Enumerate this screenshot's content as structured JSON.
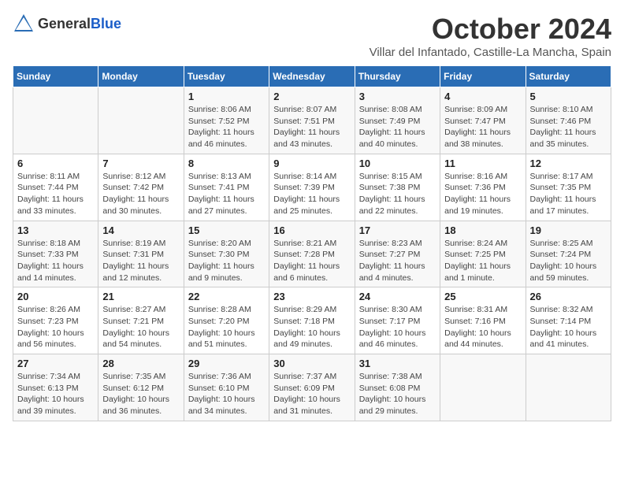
{
  "header": {
    "logo_general": "General",
    "logo_blue": "Blue",
    "month_title": "October 2024",
    "location": "Villar del Infantado, Castille-La Mancha, Spain"
  },
  "days_of_week": [
    "Sunday",
    "Monday",
    "Tuesday",
    "Wednesday",
    "Thursday",
    "Friday",
    "Saturday"
  ],
  "weeks": [
    [
      {
        "day": "",
        "info": ""
      },
      {
        "day": "",
        "info": ""
      },
      {
        "day": "1",
        "info": "Sunrise: 8:06 AM\nSunset: 7:52 PM\nDaylight: 11 hours and 46 minutes."
      },
      {
        "day": "2",
        "info": "Sunrise: 8:07 AM\nSunset: 7:51 PM\nDaylight: 11 hours and 43 minutes."
      },
      {
        "day": "3",
        "info": "Sunrise: 8:08 AM\nSunset: 7:49 PM\nDaylight: 11 hours and 40 minutes."
      },
      {
        "day": "4",
        "info": "Sunrise: 8:09 AM\nSunset: 7:47 PM\nDaylight: 11 hours and 38 minutes."
      },
      {
        "day": "5",
        "info": "Sunrise: 8:10 AM\nSunset: 7:46 PM\nDaylight: 11 hours and 35 minutes."
      }
    ],
    [
      {
        "day": "6",
        "info": "Sunrise: 8:11 AM\nSunset: 7:44 PM\nDaylight: 11 hours and 33 minutes."
      },
      {
        "day": "7",
        "info": "Sunrise: 8:12 AM\nSunset: 7:42 PM\nDaylight: 11 hours and 30 minutes."
      },
      {
        "day": "8",
        "info": "Sunrise: 8:13 AM\nSunset: 7:41 PM\nDaylight: 11 hours and 27 minutes."
      },
      {
        "day": "9",
        "info": "Sunrise: 8:14 AM\nSunset: 7:39 PM\nDaylight: 11 hours and 25 minutes."
      },
      {
        "day": "10",
        "info": "Sunrise: 8:15 AM\nSunset: 7:38 PM\nDaylight: 11 hours and 22 minutes."
      },
      {
        "day": "11",
        "info": "Sunrise: 8:16 AM\nSunset: 7:36 PM\nDaylight: 11 hours and 19 minutes."
      },
      {
        "day": "12",
        "info": "Sunrise: 8:17 AM\nSunset: 7:35 PM\nDaylight: 11 hours and 17 minutes."
      }
    ],
    [
      {
        "day": "13",
        "info": "Sunrise: 8:18 AM\nSunset: 7:33 PM\nDaylight: 11 hours and 14 minutes."
      },
      {
        "day": "14",
        "info": "Sunrise: 8:19 AM\nSunset: 7:31 PM\nDaylight: 11 hours and 12 minutes."
      },
      {
        "day": "15",
        "info": "Sunrise: 8:20 AM\nSunset: 7:30 PM\nDaylight: 11 hours and 9 minutes."
      },
      {
        "day": "16",
        "info": "Sunrise: 8:21 AM\nSunset: 7:28 PM\nDaylight: 11 hours and 6 minutes."
      },
      {
        "day": "17",
        "info": "Sunrise: 8:23 AM\nSunset: 7:27 PM\nDaylight: 11 hours and 4 minutes."
      },
      {
        "day": "18",
        "info": "Sunrise: 8:24 AM\nSunset: 7:25 PM\nDaylight: 11 hours and 1 minute."
      },
      {
        "day": "19",
        "info": "Sunrise: 8:25 AM\nSunset: 7:24 PM\nDaylight: 10 hours and 59 minutes."
      }
    ],
    [
      {
        "day": "20",
        "info": "Sunrise: 8:26 AM\nSunset: 7:23 PM\nDaylight: 10 hours and 56 minutes."
      },
      {
        "day": "21",
        "info": "Sunrise: 8:27 AM\nSunset: 7:21 PM\nDaylight: 10 hours and 54 minutes."
      },
      {
        "day": "22",
        "info": "Sunrise: 8:28 AM\nSunset: 7:20 PM\nDaylight: 10 hours and 51 minutes."
      },
      {
        "day": "23",
        "info": "Sunrise: 8:29 AM\nSunset: 7:18 PM\nDaylight: 10 hours and 49 minutes."
      },
      {
        "day": "24",
        "info": "Sunrise: 8:30 AM\nSunset: 7:17 PM\nDaylight: 10 hours and 46 minutes."
      },
      {
        "day": "25",
        "info": "Sunrise: 8:31 AM\nSunset: 7:16 PM\nDaylight: 10 hours and 44 minutes."
      },
      {
        "day": "26",
        "info": "Sunrise: 8:32 AM\nSunset: 7:14 PM\nDaylight: 10 hours and 41 minutes."
      }
    ],
    [
      {
        "day": "27",
        "info": "Sunrise: 7:34 AM\nSunset: 6:13 PM\nDaylight: 10 hours and 39 minutes."
      },
      {
        "day": "28",
        "info": "Sunrise: 7:35 AM\nSunset: 6:12 PM\nDaylight: 10 hours and 36 minutes."
      },
      {
        "day": "29",
        "info": "Sunrise: 7:36 AM\nSunset: 6:10 PM\nDaylight: 10 hours and 34 minutes."
      },
      {
        "day": "30",
        "info": "Sunrise: 7:37 AM\nSunset: 6:09 PM\nDaylight: 10 hours and 31 minutes."
      },
      {
        "day": "31",
        "info": "Sunrise: 7:38 AM\nSunset: 6:08 PM\nDaylight: 10 hours and 29 minutes."
      },
      {
        "day": "",
        "info": ""
      },
      {
        "day": "",
        "info": ""
      }
    ]
  ]
}
